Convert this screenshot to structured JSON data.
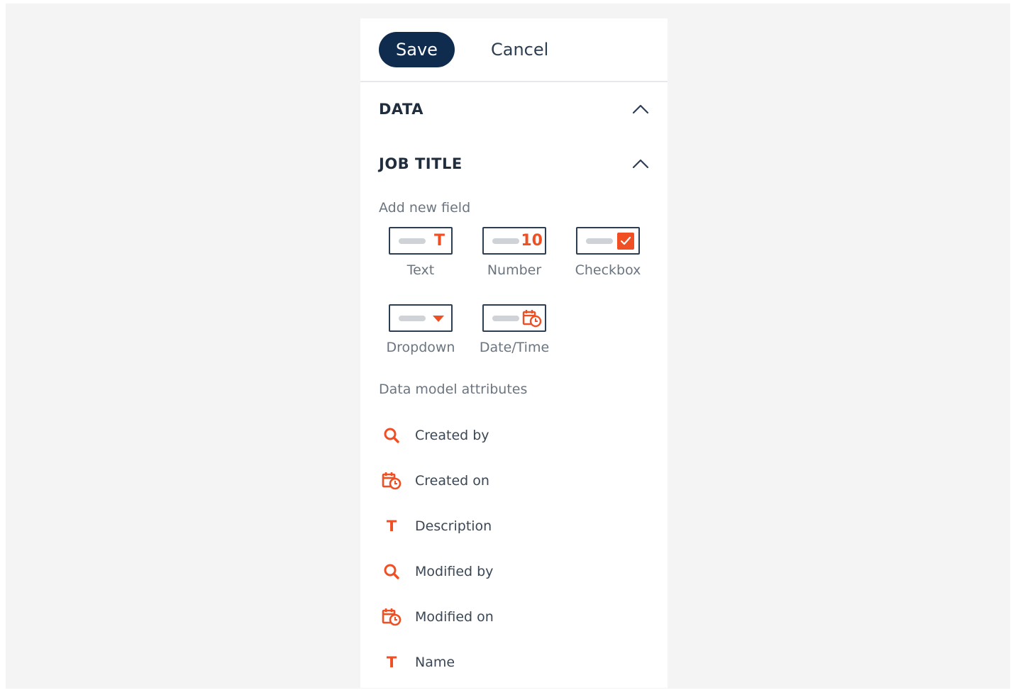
{
  "toolbar": {
    "save_label": "Save",
    "cancel_label": "Cancel"
  },
  "sections": {
    "data_title": "DATA",
    "job_title": "JOB TITLE"
  },
  "add_field": {
    "heading": "Add new field",
    "types": [
      {
        "label": "Text",
        "icon": "text-t-icon"
      },
      {
        "label": "Number",
        "icon": "number-10-icon",
        "glyph": "10"
      },
      {
        "label": "Checkbox",
        "icon": "checkbox-checked-icon"
      },
      {
        "label": "Dropdown",
        "icon": "dropdown-caret-icon"
      },
      {
        "label": "Date/Time",
        "icon": "calendar-clock-icon"
      }
    ]
  },
  "attributes": {
    "heading": "Data model attributes",
    "items": [
      {
        "label": "Created by",
        "icon": "search-icon"
      },
      {
        "label": "Created on",
        "icon": "calendar-clock-icon"
      },
      {
        "label": "Description",
        "icon": "text-t-icon"
      },
      {
        "label": "Modified by",
        "icon": "search-icon"
      },
      {
        "label": "Modified on",
        "icon": "calendar-clock-icon"
      },
      {
        "label": "Name",
        "icon": "text-t-icon"
      }
    ]
  },
  "colors": {
    "accent": "#f04e23",
    "primary": "#0f2c4e"
  }
}
